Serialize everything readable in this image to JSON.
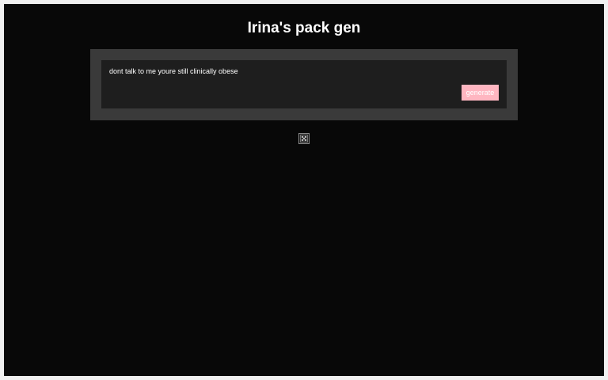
{
  "header": {
    "title": "Irina's pack gen"
  },
  "generator": {
    "output_text": "dont talk to me youre still clinically obese",
    "generate_label": "generate"
  },
  "icons": {
    "random": "dice-icon"
  },
  "colors": {
    "page_background": "#080808",
    "panel_background": "#3a3a3a",
    "output_background": "#1e1e1e",
    "button_background": "#ffb6c1",
    "text": "#ffffff"
  }
}
